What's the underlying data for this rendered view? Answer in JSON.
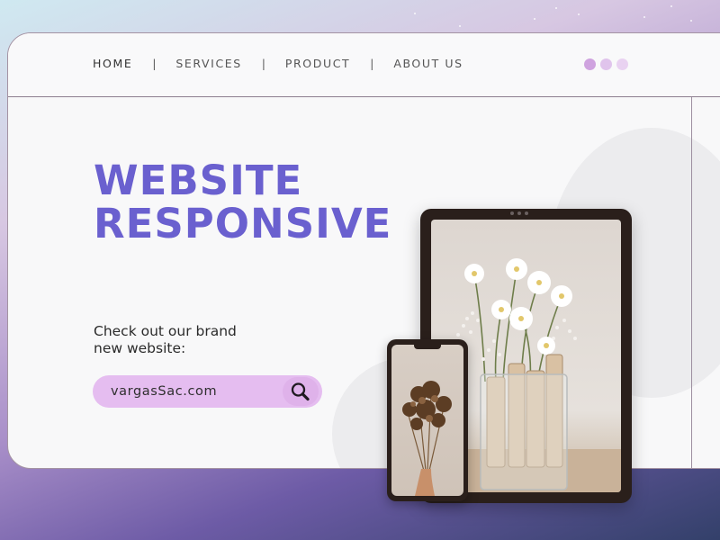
{
  "nav": {
    "items": [
      {
        "label": "HOME",
        "active": true
      },
      {
        "label": "SERVICES",
        "active": false
      },
      {
        "label": "PRODUCT",
        "active": false
      },
      {
        "label": "ABOUT US",
        "active": false
      }
    ],
    "separator": "|",
    "window_dots": [
      "#cfa3df",
      "#e0c4ec",
      "#e9d2f1"
    ]
  },
  "hero": {
    "title_line1": "WEBSITE",
    "title_line2": "RESPONSIVE",
    "subtitle_line1": "Check out our brand",
    "subtitle_line2": "new website:"
  },
  "search": {
    "value": "vargasSac.com",
    "icon": "search-icon"
  },
  "devices": {
    "tablet_image": "flowers-in-vase-photo",
    "phone_image": "dried-flower-bouquet-photo"
  },
  "colors": {
    "accent": "#6a60cf",
    "search_bg": "#e5bdf0",
    "device_frame": "#2a1f1b"
  }
}
